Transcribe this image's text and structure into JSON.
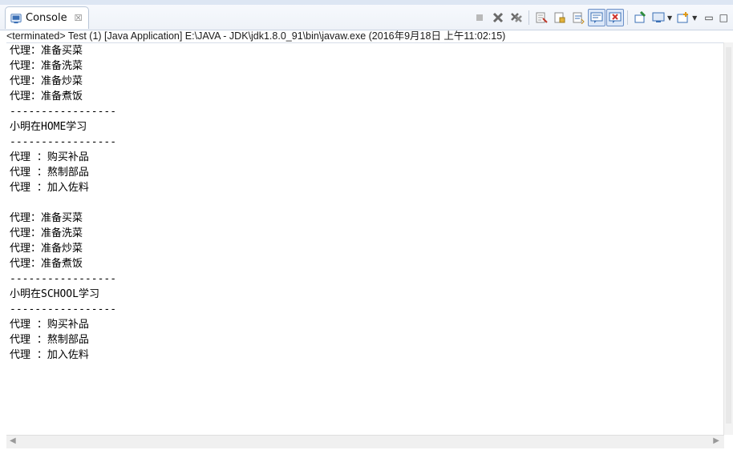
{
  "tab": {
    "label": "Console",
    "close_glyph": "☒"
  },
  "toolbar": {
    "icons": [
      "terminate-icon",
      "remove-launch-icon",
      "remove-all-terminated-icon",
      "clear-console-icon",
      "scroll-lock-icon",
      "word-wrap-icon",
      "show-on-stdout-icon",
      "show-on-stderr-icon",
      "pin-console-icon",
      "display-selected-console-icon",
      "open-console-icon",
      "minimize-icon",
      "maximize-icon"
    ]
  },
  "status": "<terminated> Test (1) [Java Application] E:\\JAVA - JDK\\jdk1.8.0_91\\bin\\javaw.exe (2016年9月18日 上午11:02:15)",
  "console_lines": [
    "代理：准备买菜",
    "代理：准备洗菜",
    "代理：准备炒菜",
    "代理：准备煮饭",
    "-----------------",
    "小明在HOME学习",
    "-----------------",
    "代理 ：购买补品",
    "代理 ：熬制部品",
    "代理 ：加入佐料",
    "",
    "代理：准备买菜",
    "代理：准备洗菜",
    "代理：准备炒菜",
    "代理：准备煮饭",
    "-----------------",
    "小明在SCHOOL学习",
    "-----------------",
    "代理 ：购买补品",
    "代理 ：熬制部品",
    "代理 ：加入佐料"
  ],
  "colors": {
    "tab_bg": "#ffffff",
    "border": "#b9c6d8",
    "accent": "#3a6fb5"
  }
}
